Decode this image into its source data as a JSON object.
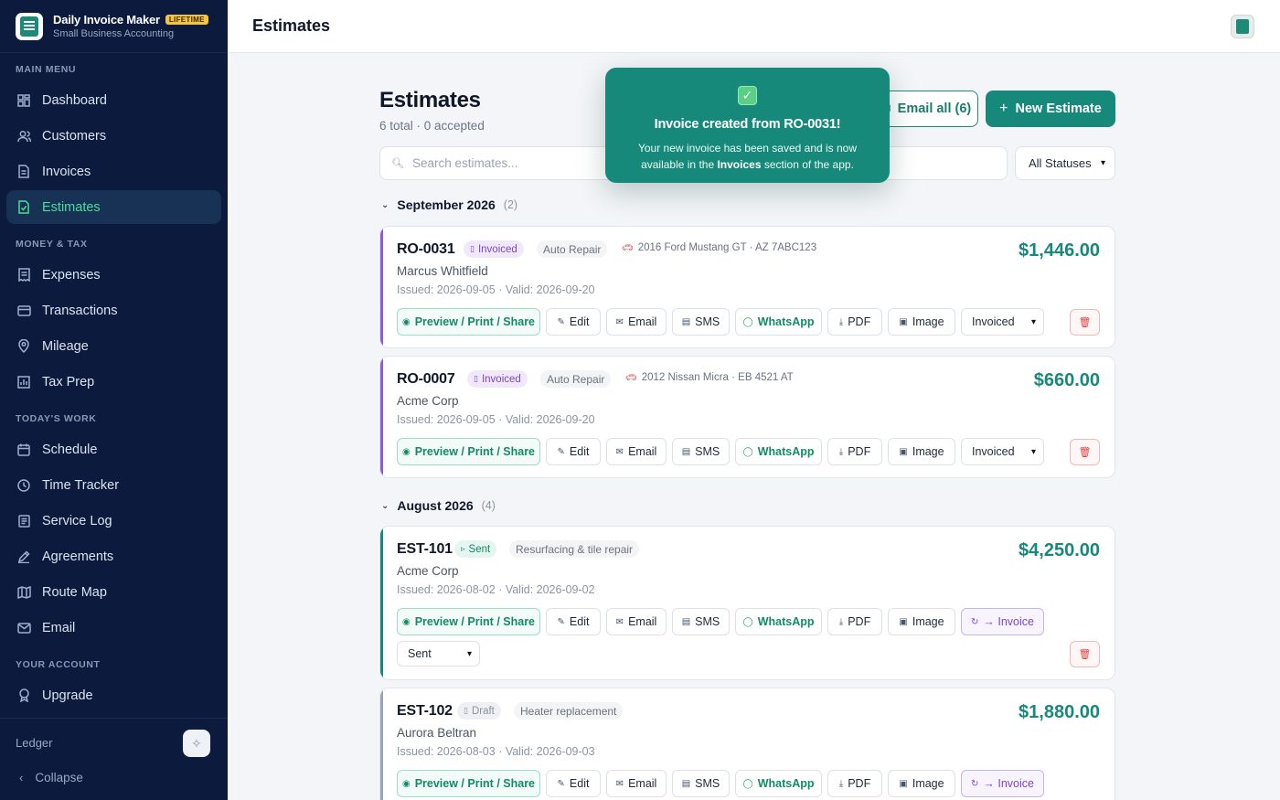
{
  "app": {
    "name": "Daily Invoice Maker",
    "badge": "LIFETIME",
    "subtitle": "Small Business Accounting"
  },
  "sidebar": {
    "sections": [
      {
        "label": "MAIN MENU",
        "items": [
          {
            "label": "Dashboard",
            "icon": "dashboard-icon"
          },
          {
            "label": "Customers",
            "icon": "users-icon"
          },
          {
            "label": "Invoices",
            "icon": "document-icon"
          },
          {
            "label": "Estimates",
            "icon": "estimate-icon",
            "active": true
          }
        ]
      },
      {
        "label": "MONEY & TAX",
        "items": [
          {
            "label": "Expenses",
            "icon": "receipt-icon"
          },
          {
            "label": "Transactions",
            "icon": "card-icon"
          },
          {
            "label": "Mileage",
            "icon": "pin-icon"
          },
          {
            "label": "Tax Prep",
            "icon": "chart-icon"
          }
        ]
      },
      {
        "label": "TODAY'S WORK",
        "items": [
          {
            "label": "Schedule",
            "icon": "calendar-icon"
          },
          {
            "label": "Time Tracker",
            "icon": "clock-icon"
          },
          {
            "label": "Service Log",
            "icon": "log-icon"
          },
          {
            "label": "Agreements",
            "icon": "pen-icon"
          },
          {
            "label": "Route Map",
            "icon": "map-icon"
          },
          {
            "label": "Email",
            "icon": "mail-icon"
          }
        ]
      },
      {
        "label": "YOUR ACCOUNT",
        "items": [
          {
            "label": "Upgrade",
            "icon": "badge-icon"
          }
        ]
      }
    ],
    "footer": {
      "ledger_label": "Ledger",
      "collapse_label": "Collapse"
    }
  },
  "topbar": {
    "title": "Estimates"
  },
  "page": {
    "title": "Estimates",
    "subtitle": "6 total · 0 accepted",
    "email_all_label": "Email all (6)",
    "new_estimate_label": "New Estimate",
    "search_placeholder": "Search estimates...",
    "status_filter": "All Statuses"
  },
  "groups": [
    {
      "label": "September 2026",
      "count": "(2)"
    },
    {
      "label": "August 2026",
      "count": "(4)"
    }
  ],
  "actions": {
    "preview": "Preview / Print / Share",
    "edit": "Edit",
    "email": "Email",
    "sms": "SMS",
    "whatsapp": "WhatsApp",
    "pdf": "PDF",
    "image": "Image",
    "to_invoice": "→ Invoice"
  },
  "estimates": [
    {
      "id": "RO-0031",
      "status": "Invoiced",
      "category": "Auto Repair",
      "vehicle": "2016 Ford Mustang GT · AZ 7ABC123",
      "customer": "Marcus Whitfield",
      "dates": "Issued: 2026-09-05 · Valid: 2026-09-20",
      "amount": "$1,446.00",
      "status_select": "Invoiced"
    },
    {
      "id": "RO-0007",
      "status": "Invoiced",
      "category": "Auto Repair",
      "vehicle": "2012 Nissan Micra · EB 4521 AT",
      "customer": "Acme Corp",
      "dates": "Issued: 2026-09-05 · Valid: 2026-09-20",
      "amount": "$660.00",
      "status_select": "Invoiced"
    },
    {
      "id": "EST-101",
      "status": "Sent",
      "category": "Resurfacing & tile repair",
      "customer": "Acme Corp",
      "dates": "Issued: 2026-08-02 · Valid: 2026-09-02",
      "amount": "$4,250.00",
      "status_select": "Sent"
    },
    {
      "id": "EST-102",
      "status": "Draft",
      "category": "Heater replacement",
      "customer": "Aurora Beltran",
      "dates": "Issued: 2026-08-03 · Valid: 2026-09-03",
      "amount": "$1,880.00"
    }
  ],
  "toast": {
    "title": "Invoice created from RO-0031!",
    "body_before": "Your new invoice has been saved and is now available in the",
    "body_bold": "Invoices",
    "body_after": "section of the app."
  }
}
